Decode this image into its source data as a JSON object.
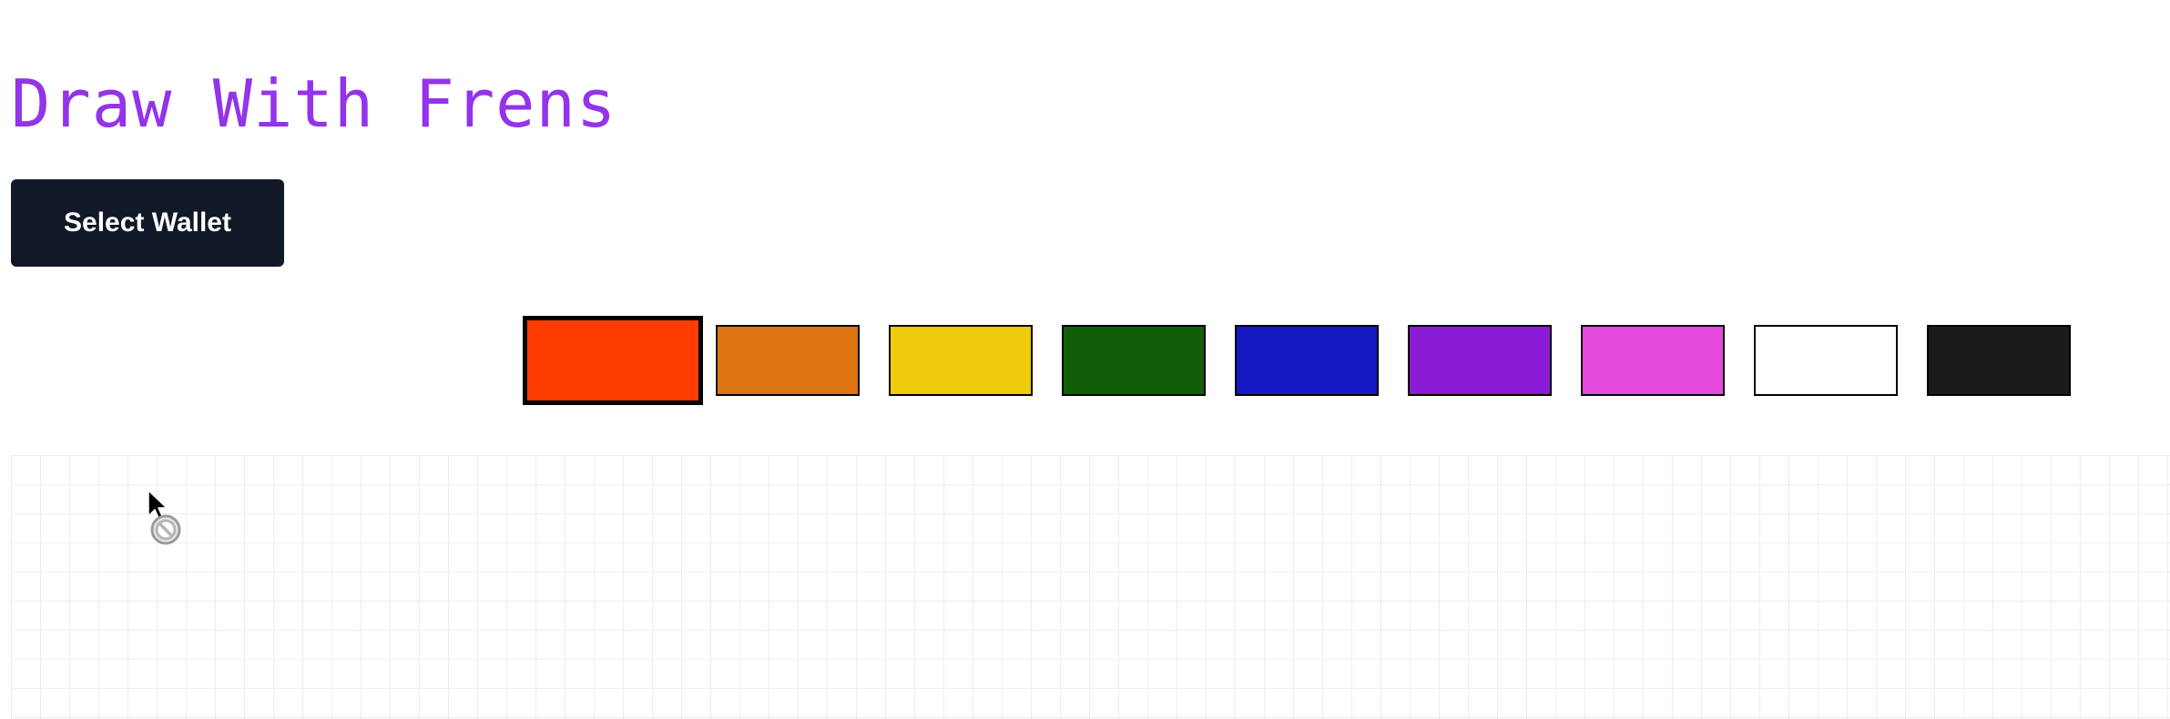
{
  "header": {
    "title": "Draw With Frens",
    "title_color": "#9333ea"
  },
  "wallet_button": {
    "label": "Select Wallet",
    "background": "#111827"
  },
  "palette": {
    "selected_index": 0,
    "colors": [
      "#ff3d00",
      "#de7410",
      "#edcc0a",
      "#105e08",
      "#1518c3",
      "#8a1cd6",
      "#e449de",
      "#ffffff",
      "#1b1b1b"
    ]
  },
  "canvas": {
    "grid_color": "#eeeeee"
  },
  "cursor": {
    "icon": "not-allowed-cursor-icon"
  }
}
